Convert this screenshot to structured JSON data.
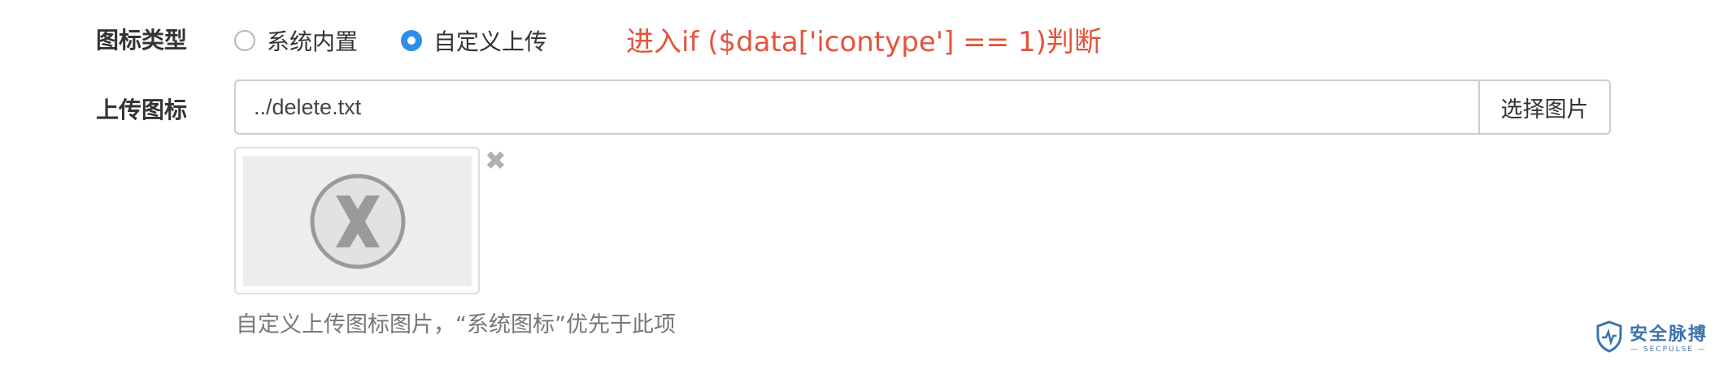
{
  "form": {
    "icon_type": {
      "label": "图标类型",
      "options": [
        {
          "label": "系统内置",
          "checked": false
        },
        {
          "label": "自定义上传",
          "checked": true
        }
      ]
    },
    "annotation": "进入if ($data['icontype'] == 1)判断",
    "upload": {
      "label": "上传图标",
      "value": "../delete.txt",
      "button_label": "选择图片",
      "remove_icon": "close-icon",
      "preview_icon": "broken-image-x-icon",
      "help_text": "自定义上传图标图片，“系统图标”优先于此项"
    }
  },
  "watermark": {
    "text": "安全脉搏",
    "subtext": "— SECPULSE —",
    "icon": "shield-icon"
  },
  "colors": {
    "accent": "#2f8fe8",
    "annotation": "#e4543c",
    "label": "#333333",
    "help": "#777777",
    "watermark": "#3d73b0"
  }
}
